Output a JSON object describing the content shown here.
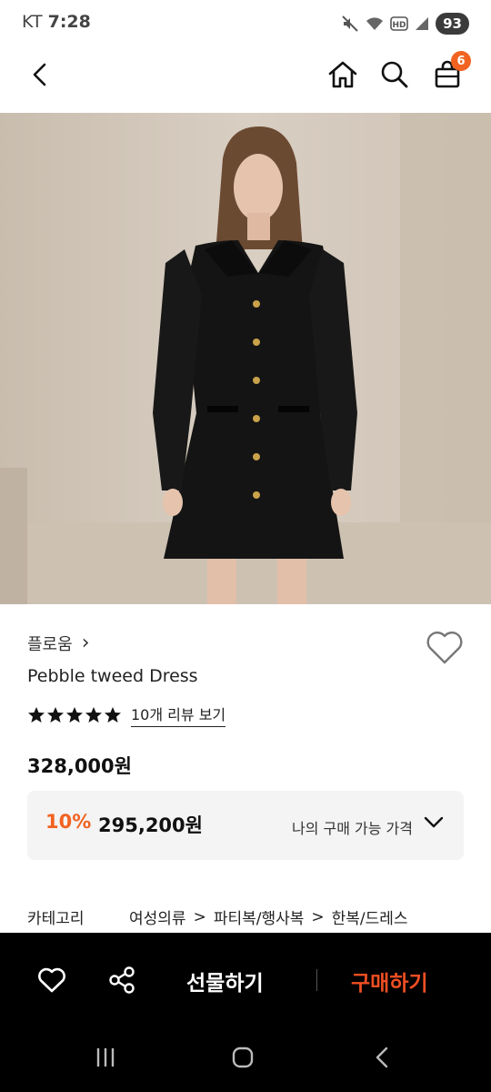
{
  "status_bar": {
    "carrier": "KT",
    "time": "7:28",
    "battery": "93",
    "icons": [
      "mute-icon",
      "wifi-icon",
      "hd-icon",
      "signal-icon"
    ]
  },
  "app_bar": {
    "back_icon": "back-arrow-icon",
    "home_icon": "home-icon",
    "search_icon": "search-icon",
    "cart_icon": "shopping-bag-icon",
    "cart_count": "6"
  },
  "product": {
    "brand": "플로움",
    "brand_chevron": "›",
    "name": "Pebble tweed Dress",
    "rating_stars": 5,
    "review_link": "10개 리뷰 보기",
    "price": "328,000원",
    "discount_rate": "10%",
    "discount_price": "295,200원",
    "my_price_label": "나의 구매 가능 가격"
  },
  "category": {
    "title": "카테고리",
    "path": [
      "여성의류",
      "파티복/행사복",
      "한복/드레스"
    ],
    "separator": ">"
  },
  "bottom_bar": {
    "gift_label": "선물하기",
    "buy_label": "구매하기"
  },
  "colors": {
    "accent": "#f26322",
    "buy": "#f04e23",
    "bottom_bar_bg": "#000000",
    "price_box_bg": "#f4f4f4"
  }
}
